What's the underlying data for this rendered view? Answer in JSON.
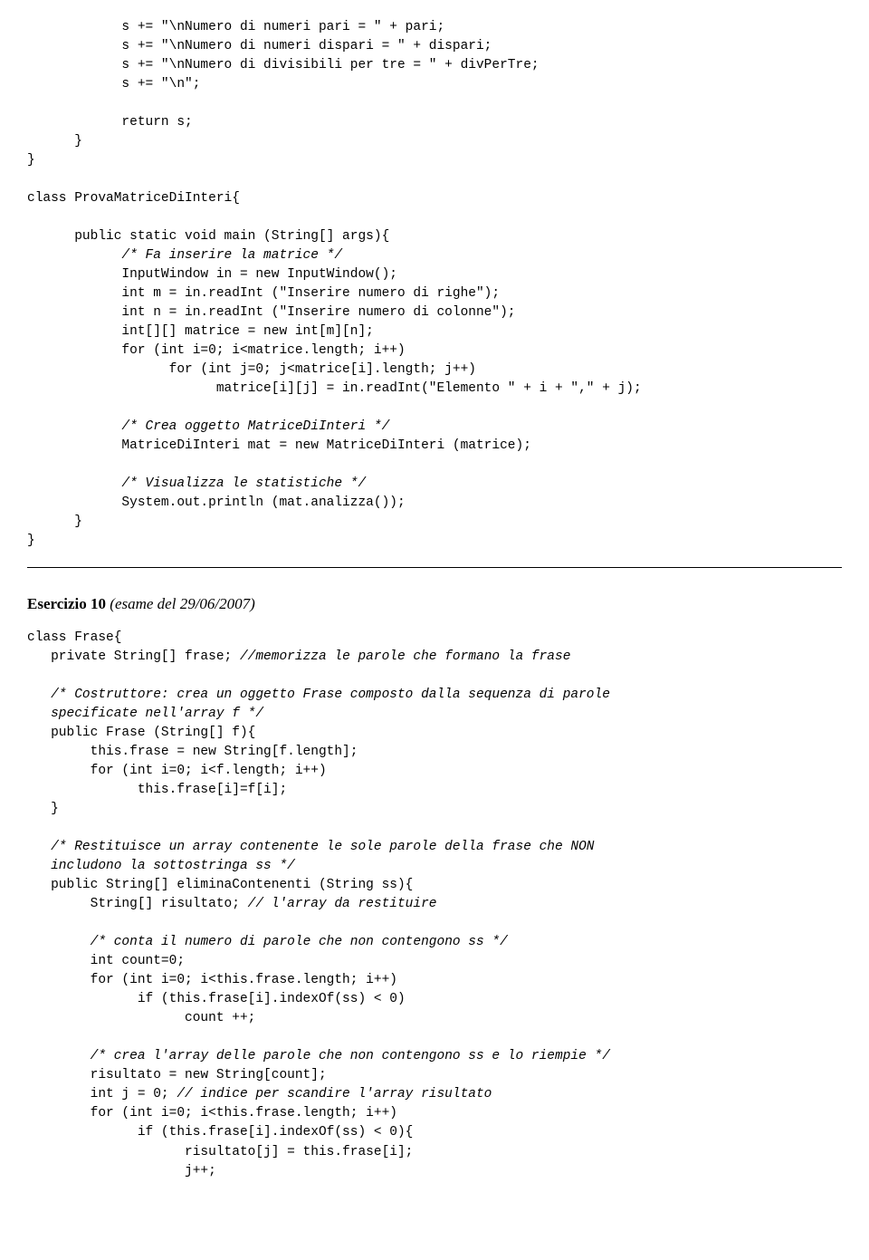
{
  "block1": {
    "l01": "            s += \"\\nNumero di numeri pari = \" + pari;",
    "l02": "            s += \"\\nNumero di numeri dispari = \" + dispari;",
    "l03": "            s += \"\\nNumero di divisibili per tre = \" + divPerTre;",
    "l04": "            s += \"\\n\";",
    "l05": "",
    "l06": "            return s;",
    "l07": "      }",
    "l08": "}",
    "l09": "",
    "l10": "class ProvaMatriceDiInteri{",
    "l11": "",
    "l12": "      public static void main (String[] args){",
    "l13a": "            ",
    "l13b": "/* Fa inserire la matrice */",
    "l14": "            InputWindow in = new InputWindow();",
    "l15": "            int m = in.readInt (\"Inserire numero di righe\");",
    "l16": "            int n = in.readInt (\"Inserire numero di colonne\");",
    "l17": "            int[][] matrice = new int[m][n];",
    "l18": "            for (int i=0; i<matrice.length; i++)",
    "l19": "                  for (int j=0; j<matrice[i].length; j++)",
    "l20": "                        matrice[i][j] = in.readInt(\"Elemento \" + i + \",\" + j);",
    "l21": "",
    "l22a": "            ",
    "l22b": "/* Crea oggetto MatriceDiInteri */",
    "l23": "            MatriceDiInteri mat = new MatriceDiInteri (matrice);",
    "l24": "",
    "l25a": "            ",
    "l25b": "/* Visualizza le statistiche */",
    "l26": "            System.out.println (mat.analizza());",
    "l27": "      }",
    "l28": "}"
  },
  "heading": {
    "bold": "Esercizio 10",
    "italic": " (esame del 29/06/2007)"
  },
  "block2": {
    "l01": "class Frase{",
    "l02a": "   private String[] frase; ",
    "l02b": "//memorizza le parole che formano la frase",
    "l03": "",
    "l04a": "   ",
    "l04b": "/* Costruttore: crea un oggetto Frase composto dalla sequenza di parole",
    "l05b": "   specificate nell'array f */",
    "l06": "   public Frase (String[] f){",
    "l07": "        this.frase = new String[f.length];",
    "l08": "        for (int i=0; i<f.length; i++)",
    "l09": "              this.frase[i]=f[i];",
    "l10": "   }",
    "l11": "",
    "l12a": "   ",
    "l12b": "/* Restituisce un array contenente le sole parole della frase che NON",
    "l13b": "   includono la sottostringa ss */",
    "l14": "   public String[] eliminaContenenti (String ss){",
    "l15a": "        String[] risultato; ",
    "l15b": "// l'array da restituire",
    "l16": "",
    "l17a": "        ",
    "l17b": "/* conta il numero di parole che non contengono ss */",
    "l18": "        int count=0;",
    "l19": "        for (int i=0; i<this.frase.length; i++)",
    "l20": "              if (this.frase[i].indexOf(ss) < 0)",
    "l21": "                    count ++;",
    "l22": "",
    "l23a": "        ",
    "l23b": "/* crea l'array delle parole che non contengono ss e lo riempie */",
    "l24": "        risultato = new String[count];",
    "l25a": "        int j = 0; ",
    "l25b": "// indice per scandire l'array risultato",
    "l26": "        for (int i=0; i<this.frase.length; i++)",
    "l27": "              if (this.frase[i].indexOf(ss) < 0){",
    "l28": "                    risultato[j] = this.frase[i];",
    "l29": "                    j++;"
  }
}
